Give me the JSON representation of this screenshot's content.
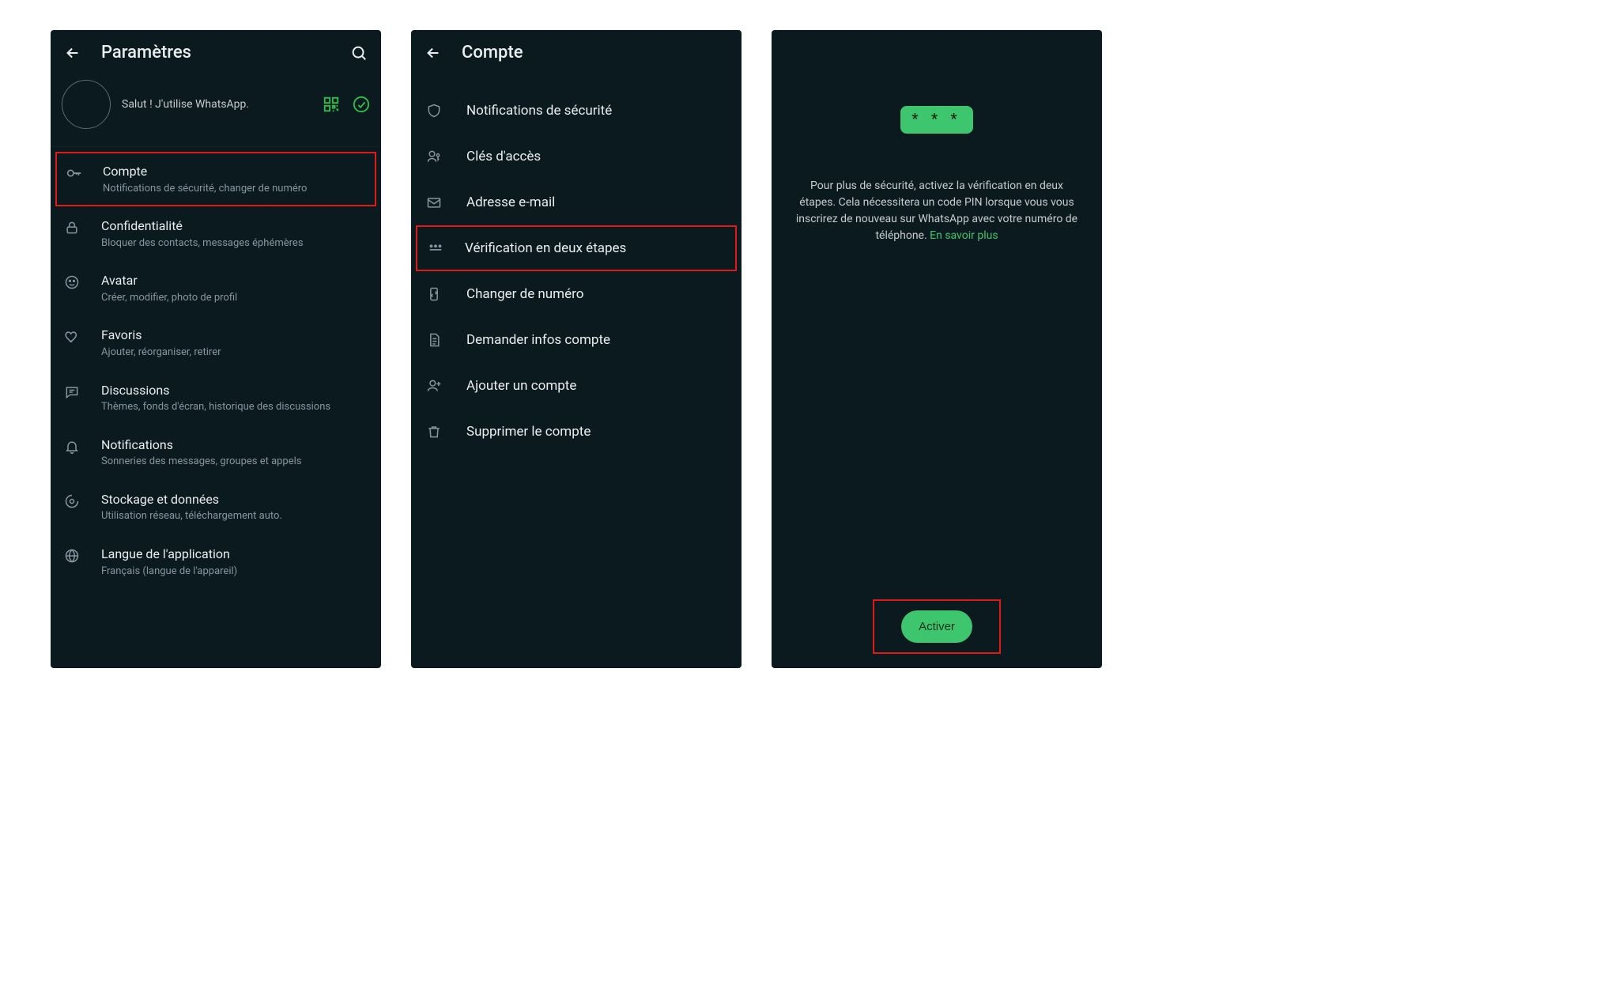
{
  "screen1": {
    "title": "Paramètres",
    "profile_status": "Salut ! J'utilise WhatsApp.",
    "items": [
      {
        "title": "Compte",
        "sub": "Notifications de sécurité, changer de numéro",
        "highlighted": true
      },
      {
        "title": "Confidentialité",
        "sub": "Bloquer des contacts, messages éphémères"
      },
      {
        "title": "Avatar",
        "sub": "Créer, modifier, photo de profil"
      },
      {
        "title": "Favoris",
        "sub": "Ajouter, réorganiser, retirer"
      },
      {
        "title": "Discussions",
        "sub": "Thèmes, fonds d'écran, historique des discussions"
      },
      {
        "title": "Notifications",
        "sub": "Sonneries des messages, groupes et appels"
      },
      {
        "title": "Stockage et données",
        "sub": "Utilisation réseau, téléchargement auto."
      },
      {
        "title": "Langue de l'application",
        "sub": "Français (langue de l'appareil)"
      }
    ]
  },
  "screen2": {
    "title": "Compte",
    "items": [
      {
        "title": "Notifications de sécurité"
      },
      {
        "title": "Clés d'accès"
      },
      {
        "title": "Adresse e-mail"
      },
      {
        "title": "Vérification en deux étapes",
        "highlighted": true
      },
      {
        "title": "Changer de numéro"
      },
      {
        "title": "Demander infos compte"
      },
      {
        "title": "Ajouter un compte"
      },
      {
        "title": "Supprimer le compte"
      }
    ]
  },
  "screen3": {
    "pin_display": "* * *",
    "body": "Pour plus de sécurité, activez la vérification en deux étapes. Cela nécessitera un code PIN lorsque vous vous inscrirez de nouveau sur WhatsApp avec votre numéro de téléphone. ",
    "link_label": "En savoir plus",
    "activate_label": "Activer"
  }
}
